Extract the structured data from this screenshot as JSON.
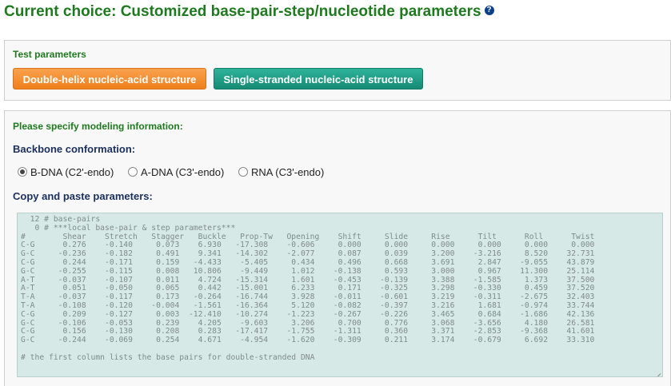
{
  "header": {
    "title": "Current choice: Customized base-pair-step/nucleotide parameters",
    "help_glyph": "?"
  },
  "test_params": {
    "label": "Test parameters",
    "buttons": [
      "Double-helix nucleic-acid structure",
      "Single-stranded nucleic-acid structure"
    ]
  },
  "modeling": {
    "label": "Please specify modeling information:",
    "backbone_heading": "Backbone conformation:",
    "options": [
      "B-DNA (C2'-endo)",
      "A-DNA (C3'-endo)",
      "RNA (C3'-endo)"
    ],
    "selected": "B-DNA (C2'-endo)",
    "paste_heading": "Copy and paste parameters:"
  },
  "params_text": [
    "  12 # base-pairs",
    "   0 # ***local base-pair & step parameters***",
    "#        Shear    Stretch   Stagger   Buckle   Prop-Tw   Opening    Shift     Slide     Rise      Tilt      Roll      Twist",
    "C-G      0.276    -0.140     0.073    6.930   -17.308    -0.606     0.000     0.000     0.000     0.000     0.000     0.000",
    "G-C     -0.236    -0.182     0.491    9.341   -14.302    -2.077     0.087     0.039     3.200    -3.216     8.520    32.731",
    "C-G      0.244    -0.171     0.159   -4.433    -5.405     0.434     0.496     0.668     3.691     2.847    -9.055    43.879",
    "G-C     -0.255    -0.115     0.008   10.806    -9.449     1.012    -0.138     0.593     3.000     0.967    11.300    25.114",
    "A-T     -0.037    -0.107     0.011    4.724   -15.314     1.601    -0.453    -0.139     3.388    -1.585     1.373    37.500",
    "A-T      0.051    -0.050     0.065    0.442   -15.001     6.233     0.171    -0.325     3.298    -0.330     0.459    37.520",
    "T-A     -0.037    -0.117     0.173   -0.264   -16.744     3.928    -0.011    -0.601     3.219    -0.311    -2.675    32.403",
    "T-A     -0.108    -0.120    -0.004   -1.561   -16.364     5.120    -0.082    -0.397     3.216     1.681    -0.974    33.744",
    "C-G      0.209    -0.127     0.003  -12.410   -10.274    -1.223    -0.267    -0.226     3.465     0.684    -1.686    42.136",
    "G-C     -0.106    -0.053     0.239    4.205    -9.603     3.206     0.700     0.776     3.068    -3.656     4.180    26.581",
    "C-G      0.156    -0.130     0.208    0.283   -17.417    -1.755    -1.311     0.360     3.371    -2.853    -9.368    41.601",
    "G-C     -0.244    -0.069     0.254    4.671    -4.954    -1.620    -0.309     0.211     3.174    -0.679     6.692    33.310",
    "",
    "# the first column lists the base pairs for double-stranded DNA"
  ],
  "colors": {
    "title_green": "#1f7a1f",
    "heading_navy": "#1b2f5c",
    "orange_button": "#ef7f1c",
    "teal_button": "#168a75",
    "textarea_bg": "#d6e9e6"
  }
}
